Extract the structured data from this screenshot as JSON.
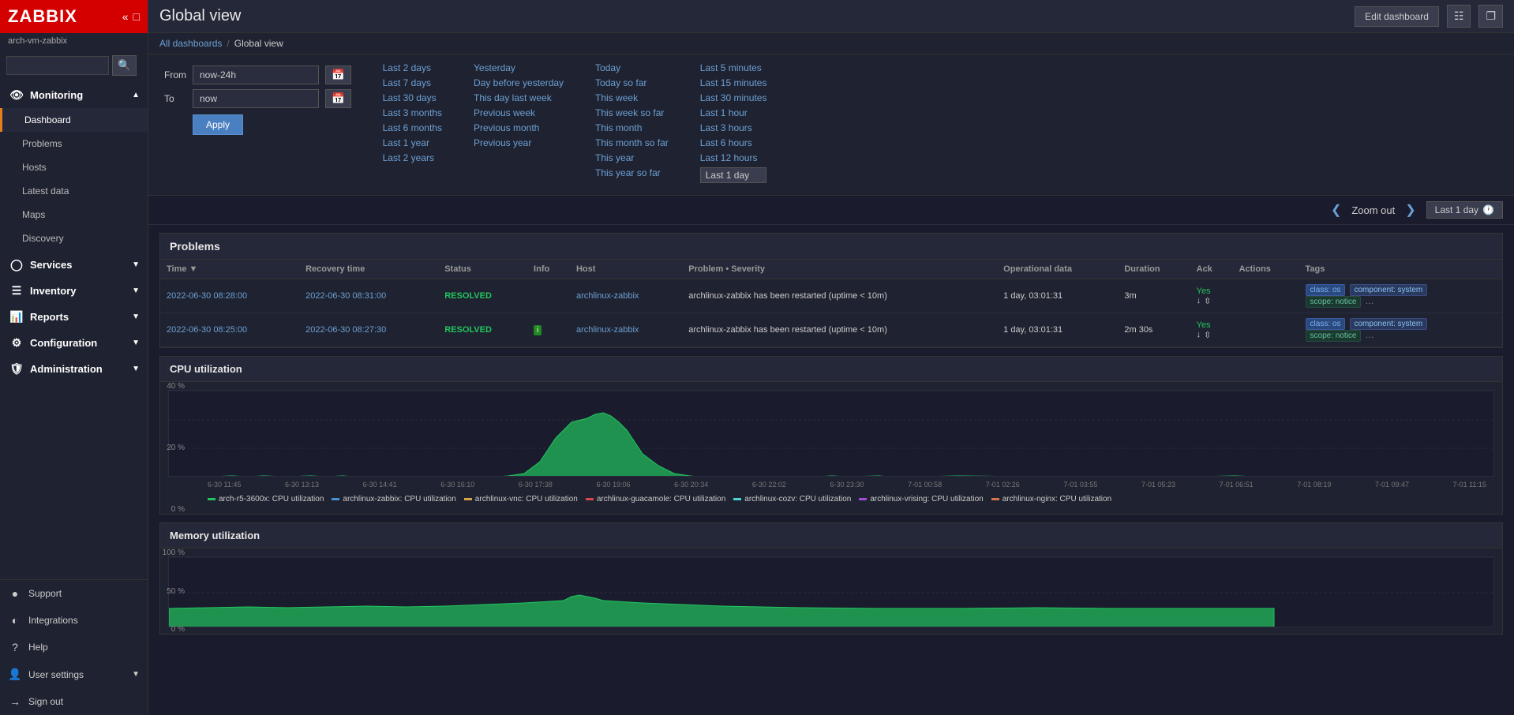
{
  "app": {
    "logo": "ZABBIX",
    "hostname": "arch-vm-zabbix"
  },
  "search": {
    "placeholder": ""
  },
  "sidebar": {
    "monitoring": {
      "label": "Monitoring",
      "items": [
        {
          "id": "dashboard",
          "label": "Dashboard",
          "active": true
        },
        {
          "id": "problems",
          "label": "Problems"
        },
        {
          "id": "hosts",
          "label": "Hosts"
        },
        {
          "id": "latest-data",
          "label": "Latest data"
        },
        {
          "id": "maps",
          "label": "Maps"
        },
        {
          "id": "discovery",
          "label": "Discovery"
        }
      ]
    },
    "services": {
      "label": "Services"
    },
    "inventory": {
      "label": "Inventory"
    },
    "reports": {
      "label": "Reports"
    },
    "configuration": {
      "label": "Configuration"
    },
    "administration": {
      "label": "Administration"
    },
    "bottom": [
      {
        "id": "support",
        "label": "Support"
      },
      {
        "id": "integrations",
        "label": "Integrations"
      },
      {
        "id": "help",
        "label": "Help"
      },
      {
        "id": "user-settings",
        "label": "User settings"
      },
      {
        "id": "sign-out",
        "label": "Sign out"
      }
    ]
  },
  "page": {
    "title": "Global view",
    "breadcrumb_all": "All dashboards",
    "breadcrumb_current": "Global view"
  },
  "time_filter": {
    "from_label": "From",
    "to_label": "To",
    "from_value": "now-24h",
    "to_value": "now",
    "apply_label": "Apply",
    "quick_links": {
      "col1": [
        "Last 2 days",
        "Last 7 days",
        "Last 30 days",
        "Last 3 months",
        "Last 6 months",
        "Last 1 year",
        "Last 2 years"
      ],
      "col2": [
        "Yesterday",
        "Day before yesterday",
        "This day last week",
        "Previous week",
        "Previous month",
        "Previous year"
      ],
      "col3": [
        "Today",
        "Today so far",
        "This week",
        "This week so far",
        "This month",
        "This month so far",
        "This year",
        "This year so far"
      ],
      "col4": [
        "Last 5 minutes",
        "Last 15 minutes",
        "Last 30 minutes",
        "Last 1 hour",
        "Last 3 hours",
        "Last 6 hours",
        "Last 12 hours",
        "Last 1 day"
      ]
    }
  },
  "zoom": {
    "label": "Zoom out",
    "period": "Last 1 day"
  },
  "problems": {
    "title": "Problems",
    "columns": [
      "Time",
      "Recovery time",
      "Status",
      "Info",
      "Host",
      "Problem • Severity",
      "Operational data",
      "Duration",
      "Ack",
      "Actions",
      "Tags"
    ],
    "rows": [
      {
        "time": "2022-06-30 08:28:00",
        "recovery": "2022-06-30 08:31:00",
        "status": "RESOLVED",
        "info": "",
        "host": "archlinux-zabbix",
        "problem": "archlinux-zabbix has been restarted (uptime < 10m)",
        "op_data": "1 day, 03:01:31",
        "duration": "3m",
        "ack": "Yes",
        "tags": [
          "class: os",
          "component: system",
          "scope: notice",
          "..."
        ]
      },
      {
        "time": "2022-06-30 08:25:00",
        "recovery": "2022-06-30 08:27:30",
        "status": "RESOLVED",
        "info": "i",
        "host": "archlinux-zabbix",
        "problem": "archlinux-zabbix has been restarted (uptime < 10m)",
        "op_data": "1 day, 03:01:31",
        "duration": "2m 30s",
        "ack": "Yes",
        "tags": [
          "class: os",
          "component: system",
          "scope: notice",
          "..."
        ]
      }
    ]
  },
  "cpu_chart": {
    "title": "CPU utilization",
    "y_labels": [
      "40 %",
      "20 %",
      "0 %"
    ],
    "x_labels": [
      "6-30 11:45",
      "6-30 13:13",
      "6-30 14:41",
      "6-30 16:10",
      "6-30 17:38",
      "6-30 19:06",
      "6-30 20:34",
      "6-30 22:02",
      "6-30 23:30",
      "7-01 00:58",
      "7-01 02:26",
      "7-01 03:55",
      "7-01 05:23",
      "7-01 06:51",
      "7-01 08:19",
      "7-01 09:47",
      "7-01 11:15"
    ],
    "legend": [
      {
        "label": "arch-r5-3600x: CPU utilization",
        "color": "#22c55e"
      },
      {
        "label": "archlinux-zabbix: CPU utilization",
        "color": "#4a90d4"
      },
      {
        "label": "archlinux-vnc: CPU utilization",
        "color": "#d4a44a"
      },
      {
        "label": "archlinux-guacamole: CPU utilization",
        "color": "#d44a4a"
      },
      {
        "label": "archlinux-cozv: CPU utilization",
        "color": "#4ad4d4"
      },
      {
        "label": "archlinux-vrising: CPU utilization",
        "color": "#a44ad4"
      },
      {
        "label": "archlinux-nginx: CPU utilization",
        "color": "#d4744a"
      }
    ]
  },
  "memory_chart": {
    "title": "Memory utilization",
    "y_labels": [
      "100 %",
      "50 %",
      "0 %"
    ]
  },
  "topbar_buttons": {
    "edit_dashboard": "Edit dashboard"
  }
}
